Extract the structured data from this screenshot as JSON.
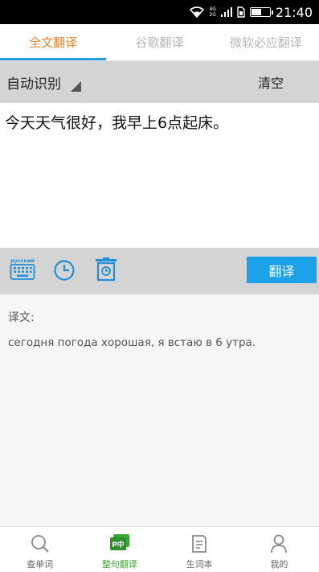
{
  "status_bar": {
    "network_top": "4G",
    "network_bottom": "2G",
    "time": "21:40",
    "battery_level": 0.55
  },
  "tabs": [
    {
      "label": "全文翻译",
      "active": true
    },
    {
      "label": "谷歌翻译",
      "active": false
    },
    {
      "label": "微软必应翻译",
      "active": false
    }
  ],
  "source": {
    "language": "自动识别",
    "clear_label": "清空",
    "text": "今天天气很好，我早上6点起床。"
  },
  "toolbar": {
    "keyboard_label": "русский",
    "translate_label": "翻译"
  },
  "result": {
    "label": "译文:",
    "text": "сегодня погода хорошая, я встаю в 6 утра."
  },
  "bottom_nav": [
    {
      "label": "查单词",
      "icon": "search-icon"
    },
    {
      "label": "整句翻译",
      "icon": "translate-icon",
      "active": true
    },
    {
      "label": "生词本",
      "icon": "notebook-icon"
    },
    {
      "label": "我的",
      "icon": "user-icon"
    }
  ],
  "colors": {
    "accent_blue": "#1aa1e8",
    "tab_active": "#e8862b",
    "nav_active": "#3aa935"
  }
}
